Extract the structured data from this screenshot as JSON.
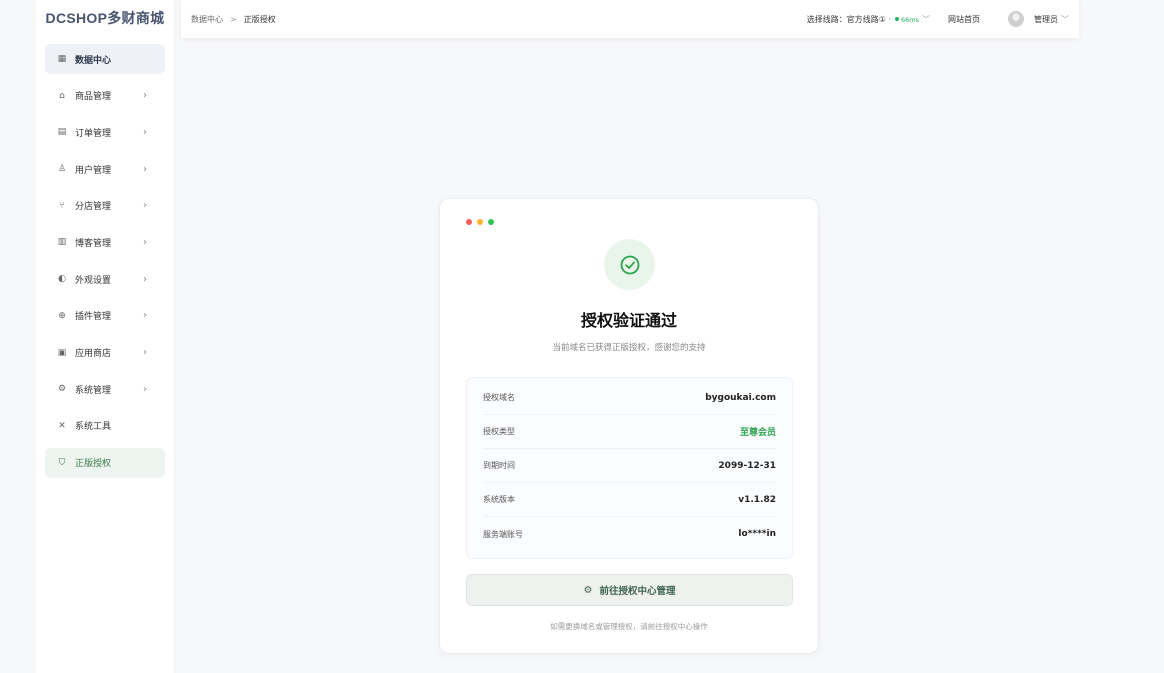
{
  "brand": "DCSHOP多财商城",
  "sidebar": {
    "items": [
      {
        "label": "数据中心",
        "icon": "dashboard-icon",
        "glyph": "▦"
      },
      {
        "label": "商品管理",
        "icon": "shopping-bag-icon",
        "glyph": "⌂"
      },
      {
        "label": "订单管理",
        "icon": "order-list-icon",
        "glyph": "▤"
      },
      {
        "label": "用户管理",
        "icon": "user-icon",
        "glyph": "♙"
      },
      {
        "label": "分店管理",
        "icon": "branch-icon",
        "glyph": "⑂"
      },
      {
        "label": "博客管理",
        "icon": "document-icon",
        "glyph": "▥"
      },
      {
        "label": "外观设置",
        "icon": "palette-icon",
        "glyph": "◐"
      },
      {
        "label": "插件管理",
        "icon": "plugin-icon",
        "glyph": "⊕"
      },
      {
        "label": "应用商店",
        "icon": "store-icon",
        "glyph": "▣"
      },
      {
        "label": "系统管理",
        "icon": "settings-icon",
        "glyph": "⚙"
      },
      {
        "label": "系统工具",
        "icon": "tools-icon",
        "glyph": "✕"
      },
      {
        "label": "正版授权",
        "icon": "shield-check-icon",
        "glyph": "⛉"
      }
    ],
    "chevron": "›"
  },
  "topbar": {
    "breadcrumb_root": "数据中心",
    "breadcrumb_sep": ">",
    "breadcrumb_current": "正版授权",
    "route_label": "选择线路：",
    "route_name": "官方线路①",
    "route_latency": "66ms",
    "home_link": "网站首页",
    "admin_name": "管理员"
  },
  "card": {
    "title": "授权验证通过",
    "subtitle": "当前域名已获得正版授权，感谢您的支持",
    "rows": [
      {
        "key": "授权域名",
        "value": "bygoukai.com"
      },
      {
        "key": "授权类型",
        "value": "至尊会员"
      },
      {
        "key": "到期时间",
        "value": "2099-12-31"
      },
      {
        "key": "系统版本",
        "value": "v1.1.82"
      },
      {
        "key": "服务端账号",
        "value": "lo****in"
      }
    ],
    "button_label": "前往授权中心管理",
    "footnote": "如需更换域名或管理授权，请前往授权中心操作"
  },
  "colors": {
    "accent_green": "#2ea44f",
    "dot_red": "#f25f5c",
    "dot_yellow": "#f8b733",
    "dot_green": "#2dc653"
  }
}
